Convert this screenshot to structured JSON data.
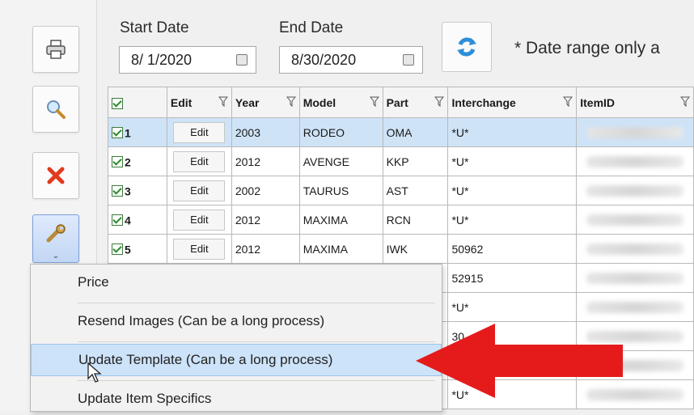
{
  "toolbar": {
    "print_icon": "printer-icon",
    "search_icon": "magnifier-icon",
    "delete_icon": "red-x-icon",
    "tools_icon": "wrench-icon",
    "tools_caret": "⌄"
  },
  "filters": {
    "start_label": "Start Date",
    "start_value": "8/ 1/2020",
    "end_label": "End Date",
    "end_value": "8/30/2020",
    "note": "* Date range only a"
  },
  "grid": {
    "headers": [
      "Edit",
      "Year",
      "Model",
      "Part",
      "Interchange",
      "ItemID"
    ],
    "edit_label": "Edit",
    "rows": [
      {
        "num": "1",
        "year": "2003",
        "model": "RODEO",
        "part": "OMA",
        "interchange": "*U*"
      },
      {
        "num": "2",
        "year": "2012",
        "model": "AVENGE",
        "part": "KKP",
        "interchange": "*U*"
      },
      {
        "num": "3",
        "year": "2002",
        "model": "TAURUS",
        "part": "AST",
        "interchange": "*U*"
      },
      {
        "num": "4",
        "year": "2012",
        "model": "MAXIMA",
        "part": "RCN",
        "interchange": "*U*"
      },
      {
        "num": "5",
        "year": "2012",
        "model": "MAXIMA",
        "part": "IWK",
        "interchange": "50962"
      },
      {
        "num": "",
        "year": "",
        "model": "",
        "part": "",
        "interchange": "52915"
      },
      {
        "num": "",
        "year": "",
        "model": "",
        "part": "",
        "interchange": "*U*"
      },
      {
        "num": "",
        "year": "",
        "model": "",
        "part": "",
        "interchange": "30"
      },
      {
        "num": "",
        "year": "",
        "model": "",
        "part": "",
        "interchange": ""
      },
      {
        "num": "",
        "year": "",
        "model": "",
        "part": "",
        "interchange": "*U*"
      }
    ]
  },
  "menu": {
    "items": [
      "Price",
      "Resend Images (Can be a long process)",
      "Update Template (Can be a long process)",
      "Update Item Specifics"
    ],
    "highlighted_index": 2
  },
  "colors": {
    "selected_row": "#cfe3f7",
    "menu_highlight": "#cde3f9",
    "arrow": "#e51b1b"
  }
}
